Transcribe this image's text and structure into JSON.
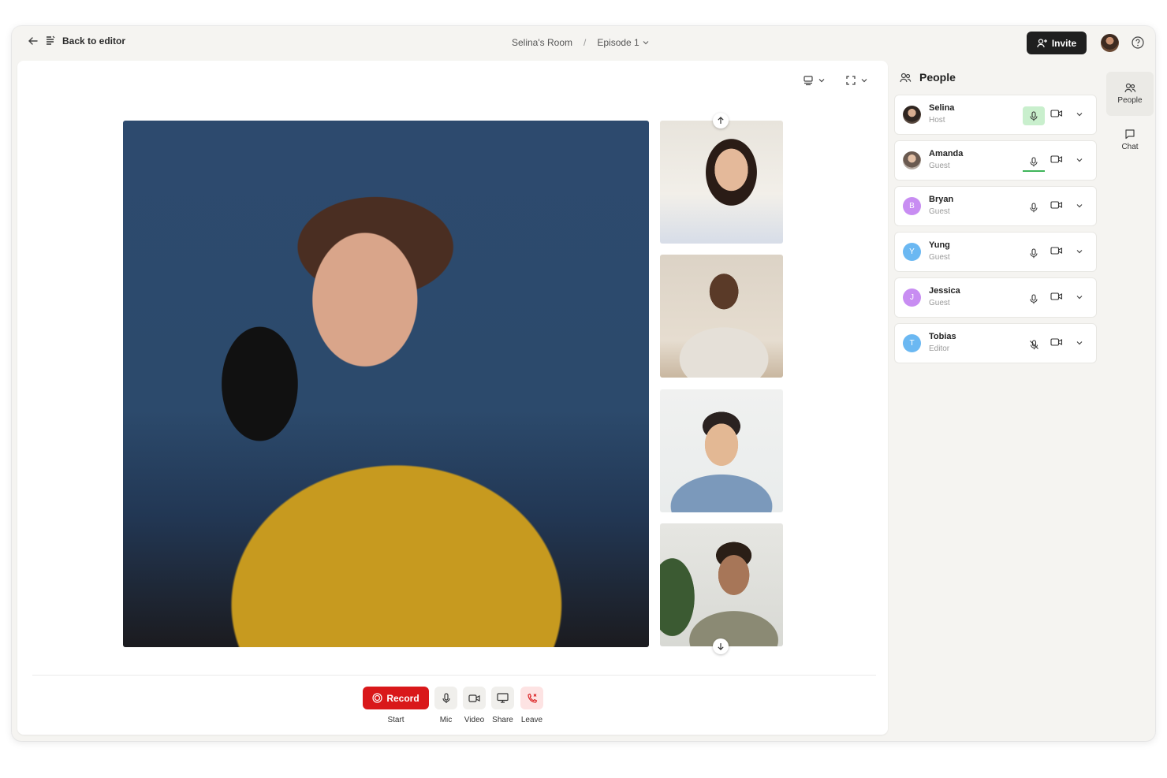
{
  "topbar": {
    "back_label": "Back to editor",
    "room": "Selina's Room",
    "separator": "/",
    "episode": "Episode 1",
    "invite_label": "Invite"
  },
  "controls": {
    "record_label": "Record",
    "start_label": "Start",
    "mic_label": "Mic",
    "video_label": "Video",
    "share_label": "Share",
    "leave_label": "Leave"
  },
  "people_panel": {
    "title": "People",
    "people": [
      {
        "name": "Selina",
        "role": "Host",
        "initial": "",
        "color": "#5a4a40",
        "mic": "speaking"
      },
      {
        "name": "Amanda",
        "role": "Guest",
        "initial": "",
        "color": "#8a7b70",
        "mic": "active"
      },
      {
        "name": "Bryan",
        "role": "Guest",
        "initial": "B",
        "color": "#c88df2",
        "mic": "on"
      },
      {
        "name": "Yung",
        "role": "Guest",
        "initial": "Y",
        "color": "#6bb8f2",
        "mic": "on"
      },
      {
        "name": "Jessica",
        "role": "Guest",
        "initial": "J",
        "color": "#c88df2",
        "mic": "on"
      },
      {
        "name": "Tobias",
        "role": "Editor",
        "initial": "T",
        "color": "#6bb8f2",
        "mic": "muted"
      }
    ]
  },
  "rail": {
    "people_label": "People",
    "chat_label": "Chat"
  },
  "colors": {
    "record": "#d9181a",
    "invite_bg": "#1f1f1f",
    "speaking": "#c9efcd"
  }
}
